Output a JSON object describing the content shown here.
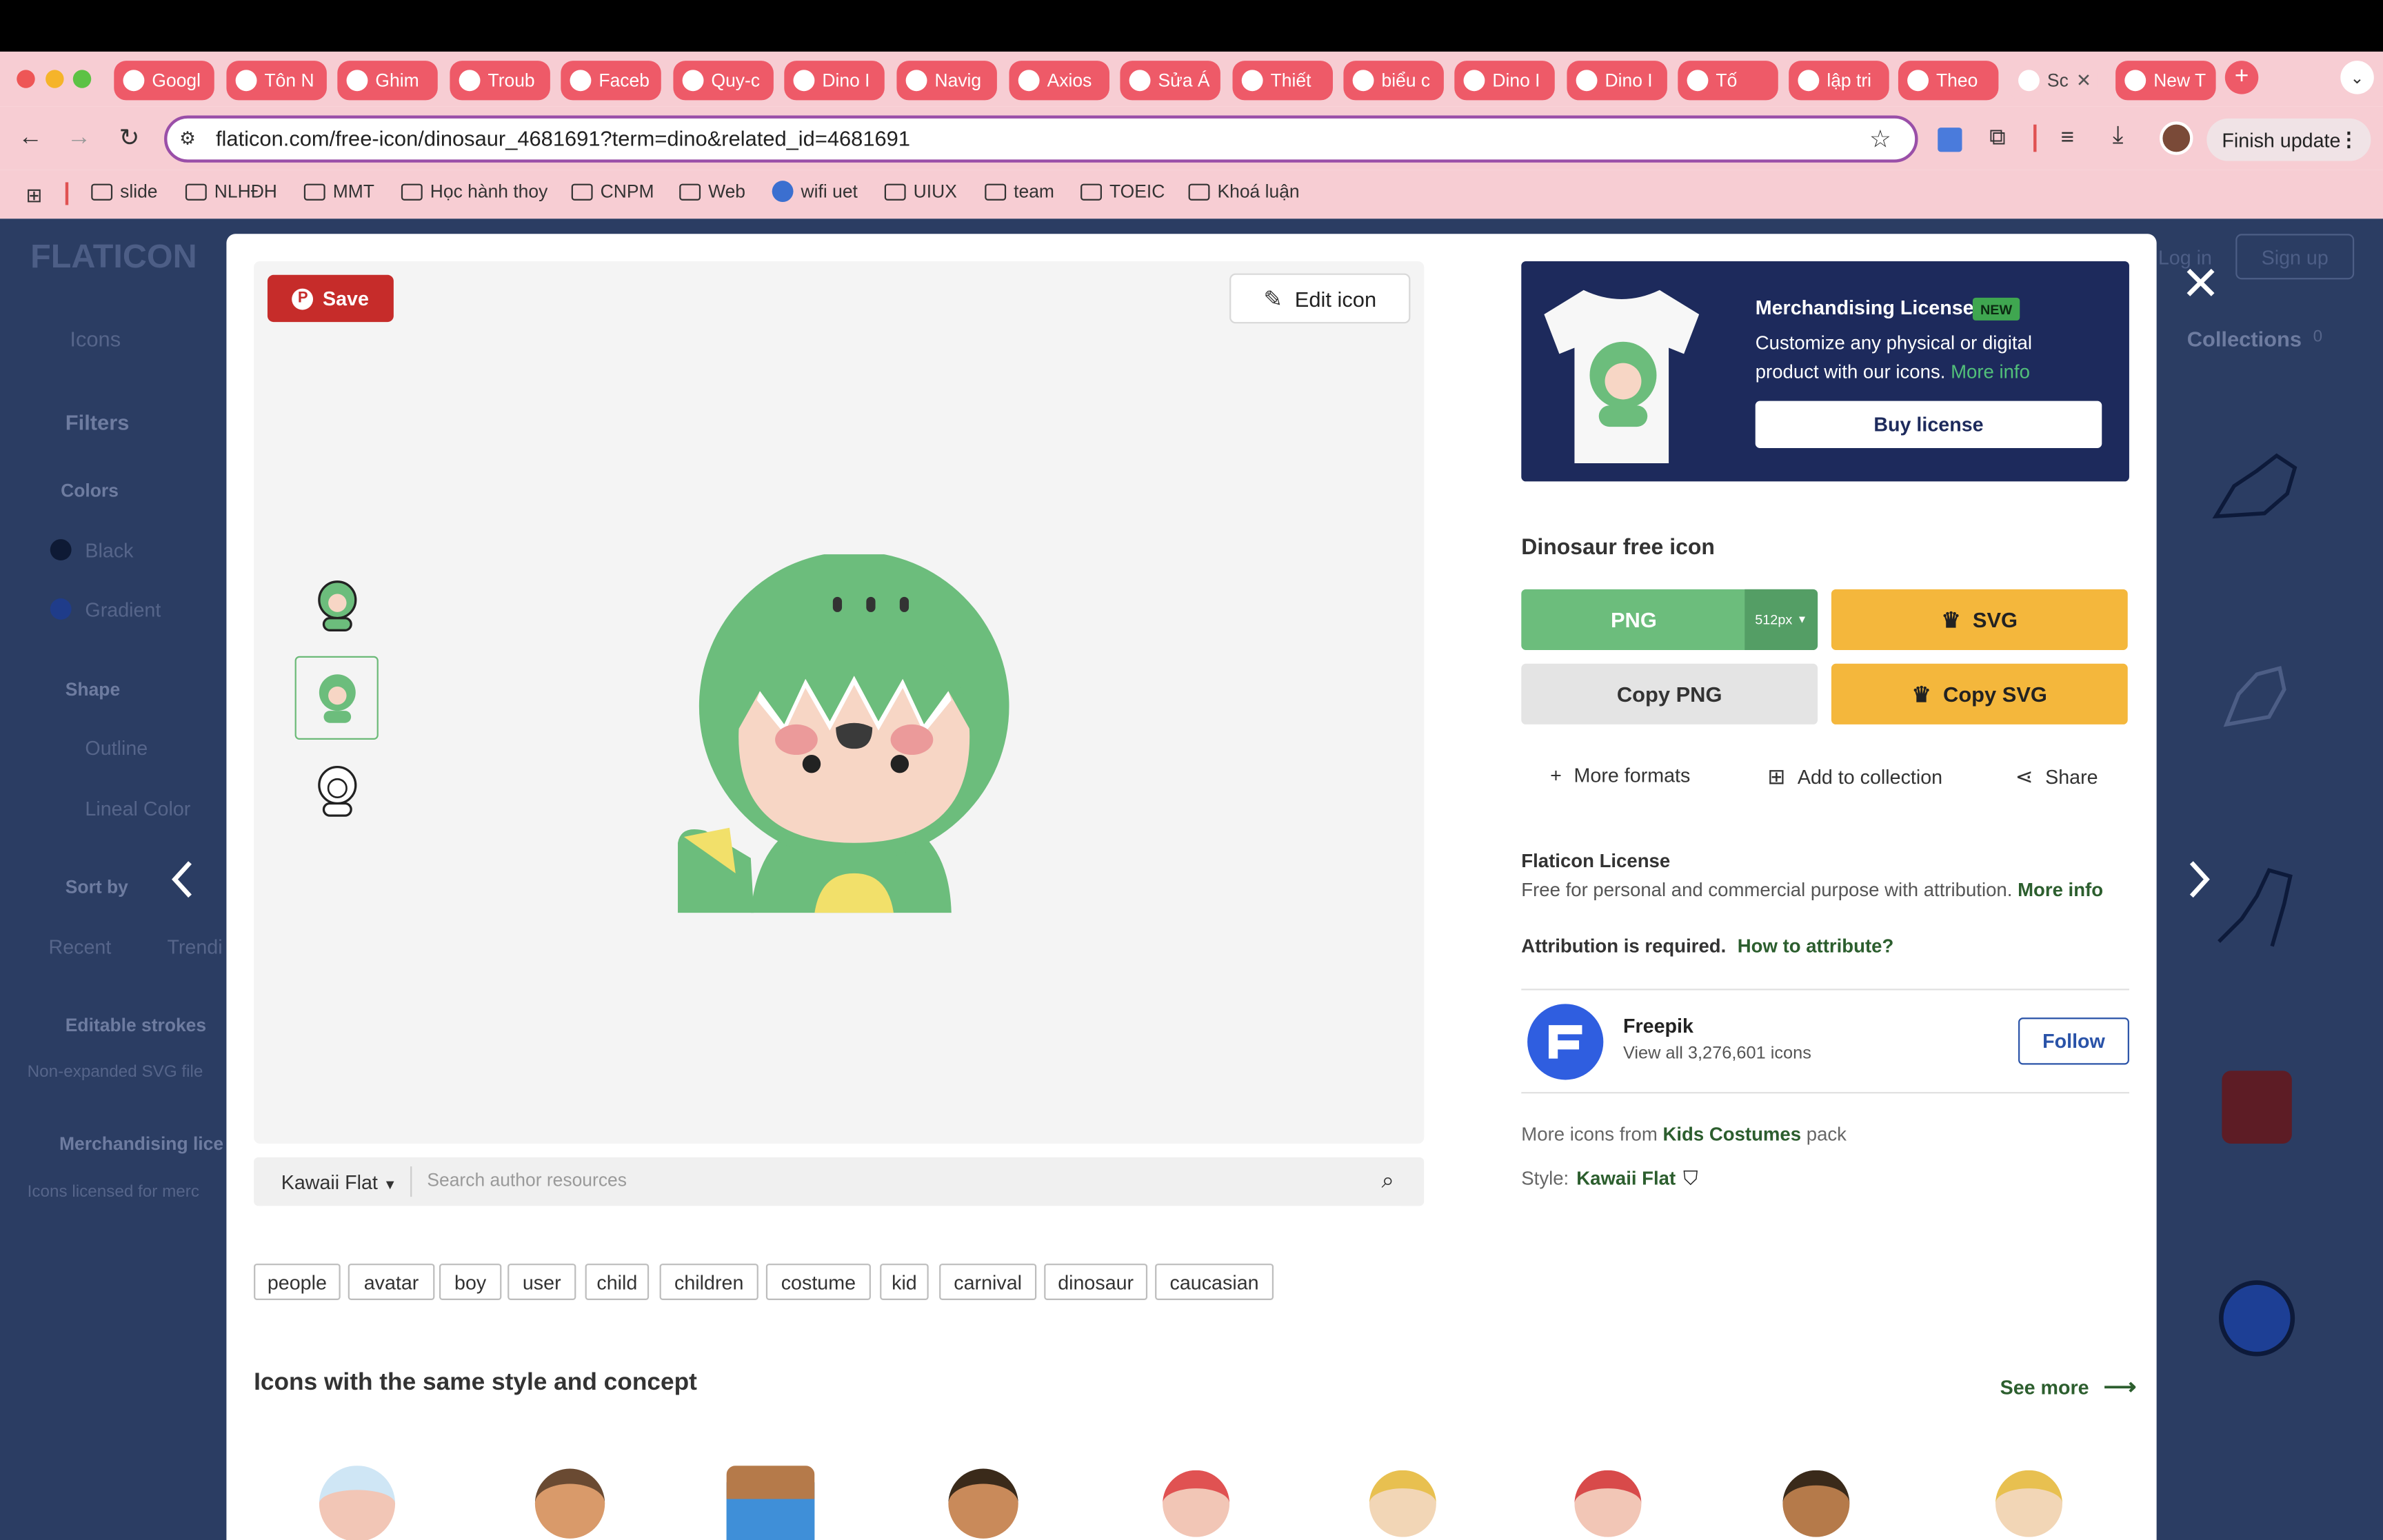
{
  "browser": {
    "tabs": [
      {
        "label": "Googl",
        "icon": "google-translate-icon"
      },
      {
        "label": "Tôn N",
        "icon": "youtube-icon"
      },
      {
        "label": "Ghim",
        "icon": "pinterest-icon"
      },
      {
        "label": "Troub",
        "icon": "generic-icon"
      },
      {
        "label": "Faceb",
        "icon": "facebook-icon"
      },
      {
        "label": "Quy-c",
        "icon": "globe-icon"
      },
      {
        "label": "Dino I",
        "icon": "dino-icon"
      },
      {
        "label": "Navig",
        "icon": "openai-icon"
      },
      {
        "label": "Axios",
        "icon": "openai-icon"
      },
      {
        "label": "Sửa Á",
        "icon": "loop-icon"
      },
      {
        "label": "Thiết",
        "icon": "doc-icon"
      },
      {
        "label": "biểu c",
        "icon": "chart-icon"
      },
      {
        "label": "Dino I",
        "icon": "dino-icon"
      },
      {
        "label": "Dino I",
        "icon": "dino-icon"
      },
      {
        "label": "Tố",
        "icon": "youtube-icon"
      },
      {
        "label": "lập tri",
        "icon": "drive-icon"
      },
      {
        "label": "Theo",
        "icon": "sheets-icon"
      },
      {
        "label": "Sc",
        "icon": "flaticon-icon",
        "active": true
      },
      {
        "label": "New T",
        "icon": "chrome-icon"
      }
    ],
    "url": "flaticon.com/free-icon/dinosaur_4681691?term=dino&related_id=4681691",
    "finish_update": "Finish update",
    "bookmarks": [
      "slide",
      "NLHĐH",
      "MMT",
      "Học hành thoy",
      "CNPM",
      "Web",
      "wifi uet",
      "UIUX",
      "team",
      "TOEIC",
      "Khoá luận"
    ]
  },
  "background_page": {
    "logo": "FLATICON",
    "nav_icons": "Icons",
    "filters": "Filters",
    "colors": "Colors",
    "black": "Black",
    "gradient": "Gradient",
    "shape": "Shape",
    "outline": "Outline",
    "lineal_color": "Lineal Color",
    "sort_by": "Sort by",
    "recent": "Recent",
    "trending": "Trendi",
    "editable_strokes": "Editable strokes",
    "non_expanded": "Non-expanded SVG file",
    "merch_license": "Merchandising lice",
    "licensed_for": "Icons licensed for merc",
    "login": "Log in",
    "signup": "Sign up",
    "collections": "Collections",
    "collections_count": "0"
  },
  "modal": {
    "save_label": "Save",
    "edit_label": "Edit icon",
    "style_select": "Kawaii Flat",
    "search_placeholder": "Search author resources",
    "tags": [
      "people",
      "avatar",
      "boy",
      "user",
      "child",
      "children",
      "costume",
      "kid",
      "carnival",
      "dinosaur",
      "caucasian"
    ],
    "same_style_title": "Icons with the same style and concept",
    "see_more": "See more"
  },
  "sidebar": {
    "merch_title": "Merchandising License",
    "merch_badge": "NEW",
    "merch_desc": "Customize any physical or digital product with our icons.",
    "merch_more": "More info",
    "buy_license": "Buy license",
    "icon_title": "Dinosaur free icon",
    "png_label": "PNG",
    "png_size": "512px",
    "svg_label": "SVG",
    "copy_png": "Copy PNG",
    "copy_svg": "Copy SVG",
    "more_formats": "More formats",
    "add_collection": "Add to collection",
    "share": "Share",
    "license_title": "Flaticon License",
    "license_desc": "Free for personal and commercial purpose with attribution.",
    "license_more": "More info",
    "attr_required": "Attribution is required.",
    "how_to_attr": "How to attribute?",
    "author_name": "Freepik",
    "author_sub": "View all 3,276,601 icons",
    "follow": "Follow",
    "more_from_prefix": "More icons from",
    "pack_name": "Kids Costumes",
    "more_from_suffix": "pack",
    "style_label": "Style:",
    "style_name": "Kawaii Flat"
  },
  "colors": {
    "accent_green": "#6cbd7c",
    "premium_yellow": "#f4b73c",
    "navy": "#1d2a5c",
    "save_red": "#c62c2a"
  }
}
